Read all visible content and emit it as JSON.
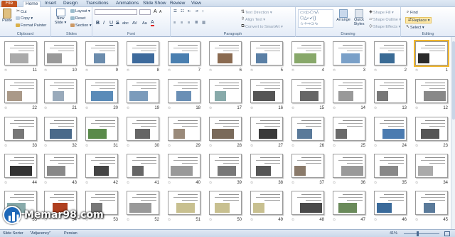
{
  "tabs": [
    "File",
    "Home",
    "Insert",
    "Design",
    "Transitions",
    "Animations",
    "Slide Show",
    "Review",
    "View"
  ],
  "ribbon": {
    "clipboard": {
      "label": "Clipboard",
      "paste": "Paste",
      "cut": "Cut",
      "copy": "Copy ▾",
      "format_painter": "Format Painter"
    },
    "slides": {
      "label": "Slides",
      "new_slide": "New Slide ▾",
      "layout": "Layout ▾",
      "reset": "Reset",
      "section": "Section ▾"
    },
    "font": {
      "label": "Font",
      "bold": "B",
      "italic": "I",
      "underline": "U",
      "strike": "S",
      "shadow": "abc",
      "spacing": "AV",
      "case": "Aa",
      "color": "A"
    },
    "paragraph": {
      "label": "Paragraph",
      "text_direction": "Text Direction ▾",
      "align_text": "Align Text ▾",
      "smartart": "Convert to SmartArt ▾"
    },
    "drawing": {
      "label": "Drawing",
      "arrange": "Arrange",
      "quick_styles": "Quick Styles",
      "shape_fill": "Shape Fill ▾",
      "shape_outline": "Shape Outline ▾",
      "shape_effects": "Shape Effects ▾"
    },
    "editing": {
      "label": "Editing",
      "find": "Find",
      "replace": "Replace ▾",
      "select": "Select ▾"
    }
  },
  "slides": [
    {
      "n": "1",
      "img": "#2a2a2a",
      "sel": true
    },
    {
      "n": "2",
      "img": "#3a6b95"
    },
    {
      "n": "3",
      "img": "#7aa0c8"
    },
    {
      "n": "4",
      "img": "#88a86a"
    },
    {
      "n": "5",
      "img": "#5a7fa5"
    },
    {
      "n": "6",
      "img": "#8a6a50"
    },
    {
      "n": "7",
      "img": "#4a7fb0"
    },
    {
      "n": "8",
      "img": "#3d6a9c"
    },
    {
      "n": "9",
      "img": "#6b8cad"
    },
    {
      "n": "10",
      "img": "#999"
    },
    {
      "n": "11",
      "img": "#aaa"
    },
    {
      "n": "12",
      "img": "#888"
    },
    {
      "n": "13",
      "img": "#777"
    },
    {
      "n": "14",
      "img": "#999"
    },
    {
      "n": "15",
      "img": "#666"
    },
    {
      "n": "16",
      "img": "#555"
    },
    {
      "n": "17",
      "img": "#8aa"
    },
    {
      "n": "18",
      "img": "#6a8fb5"
    },
    {
      "n": "19",
      "img": "#7b9bbb"
    },
    {
      "n": "20",
      "img": "#5b8bb8"
    },
    {
      "n": "21",
      "img": "#9ab"
    },
    {
      "n": "22",
      "img": "#a98"
    },
    {
      "n": "23",
      "img": "#555"
    },
    {
      "n": "24",
      "img": "#4b7bb0"
    },
    {
      "n": "25",
      "img": "#6a6a6a"
    },
    {
      "n": "26",
      "img": "#5a7a9a"
    },
    {
      "n": "27",
      "img": "#3a3a3a"
    },
    {
      "n": "28",
      "img": "#7a6a5a"
    },
    {
      "n": "29",
      "img": "#9a8a7a"
    },
    {
      "n": "30",
      "img": "#666"
    },
    {
      "n": "31",
      "img": "#5a8a4a"
    },
    {
      "n": "32",
      "img": "#4a6a8a"
    },
    {
      "n": "33",
      "img": "#777"
    },
    {
      "n": "34",
      "img": "#aaa"
    },
    {
      "n": "35",
      "img": "#888"
    },
    {
      "n": "36",
      "img": "#999"
    },
    {
      "n": "37",
      "img": "#8a7a6a"
    },
    {
      "n": "38",
      "img": "#555"
    },
    {
      "n": "39",
      "img": "#777"
    },
    {
      "n": "40",
      "img": "#999"
    },
    {
      "n": "41",
      "img": "#666"
    },
    {
      "n": "42",
      "img": "#444"
    },
    {
      "n": "43",
      "img": "#888"
    },
    {
      "n": "44",
      "img": "#333"
    },
    {
      "n": "45",
      "img": "#5a7a9a"
    },
    {
      "n": "46",
      "img": "#3a6a9a"
    },
    {
      "n": "47",
      "img": "#6a8a5a"
    },
    {
      "n": "48",
      "img": "#4a4a4a"
    },
    {
      "n": "49",
      "img": "#c8c090"
    },
    {
      "n": "50",
      "img": "#c8c090"
    },
    {
      "n": "51",
      "img": "#c8c090"
    },
    {
      "n": "52",
      "img": "#999"
    },
    {
      "n": "53",
      "img": "#777"
    },
    {
      "n": "54",
      "img": "#b04020"
    },
    {
      "n": "55",
      "img": "#8aa"
    }
  ],
  "status": {
    "view": "Slide Sorter",
    "theme": "\"Adjacency\"",
    "lang": "Persian",
    "zoom": "41%"
  },
  "watermark": {
    "text": "Memar98.com"
  },
  "colors": {
    "accent": "#c2541f",
    "ribbon_text": "#1e395b",
    "selection": "#f1b62c"
  }
}
